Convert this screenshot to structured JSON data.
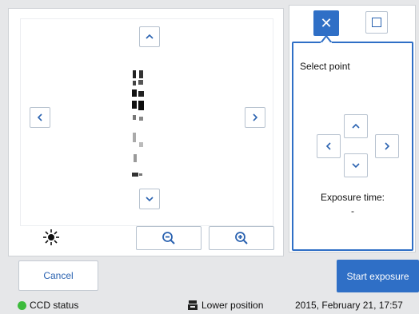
{
  "preview": {
    "icons": {
      "up": "chevron-up-icon",
      "down": "chevron-down-icon",
      "left": "chevron-left-icon",
      "right": "chevron-right-icon"
    }
  },
  "toolbar": {
    "brightness_icon": "brightness-icon",
    "zoom_out_icon": "zoom-out-icon",
    "zoom_in_icon": "zoom-in-icon"
  },
  "tools": {
    "point_icon": "close-icon",
    "area_icon": "square-icon"
  },
  "select": {
    "label": "Select point",
    "exposure_label": "Exposure time:",
    "exposure_value": "-"
  },
  "actions": {
    "cancel": "Cancel",
    "start": "Start exposure"
  },
  "status": {
    "ccd": "CCD status",
    "ccd_color": "#3dbb3d",
    "position": "Lower position",
    "datetime": "2015, February 21, 17:57"
  },
  "colors": {
    "accent": "#2f6fc6"
  }
}
